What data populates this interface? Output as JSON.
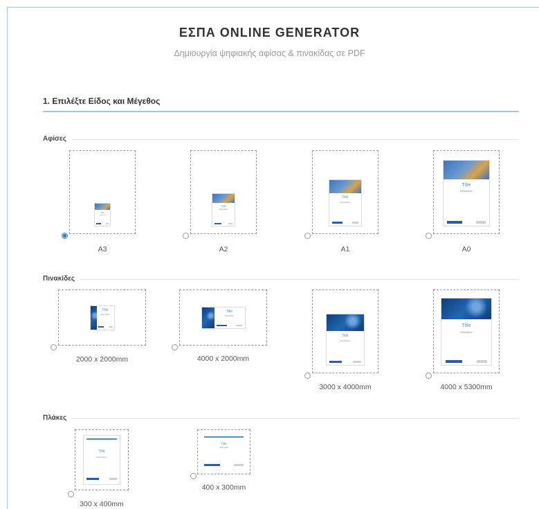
{
  "header": {
    "title": "ΕΣΠΑ ONLINE GENERATOR",
    "subtitle": "Δημιουργία ψηφιακής αφίσας & πινακίδας σε PDF"
  },
  "step": {
    "label": "1. Επιλέξτε Είδος και Μέγεθος"
  },
  "categories": {
    "posters": "Αφίσες",
    "signs": "Πινακίδες",
    "plates": "Πλάκες"
  },
  "posters": [
    {
      "size": "A3",
      "selected": true,
      "thumb_title": "Title",
      "thumb_desc": "Description"
    },
    {
      "size": "A2",
      "selected": false,
      "thumb_title": "Title",
      "thumb_desc": "Description"
    },
    {
      "size": "A1",
      "selected": false,
      "thumb_title": "Title",
      "thumb_desc": "Description"
    },
    {
      "size": "A0",
      "selected": false,
      "thumb_title": "Title",
      "thumb_desc": "Description"
    }
  ],
  "signs": [
    {
      "size": "2000 x 2000mm",
      "selected": false,
      "thumb_title": "Title",
      "thumb_desc": "Description"
    },
    {
      "size": "4000 x 2000mm",
      "selected": false,
      "thumb_title": "Title",
      "thumb_desc": "Description"
    },
    {
      "size": "3000 x 4000mm",
      "selected": false,
      "thumb_title": "Title",
      "thumb_desc": "Description"
    },
    {
      "size": "4000 x 5300mm",
      "selected": false,
      "thumb_title": "Title",
      "thumb_desc": "Description"
    }
  ],
  "plates": [
    {
      "size": "300 x 400mm",
      "selected": false,
      "thumb_title": "Title",
      "thumb_desc": "Description"
    },
    {
      "size": "400 x 300mm",
      "selected": false,
      "thumb_title": "Title",
      "thumb_desc": "Description"
    }
  ],
  "colors": {
    "accent": "#2e7bd6",
    "divider": "#a8c4de",
    "thumb_title": "#4a8fd6"
  }
}
